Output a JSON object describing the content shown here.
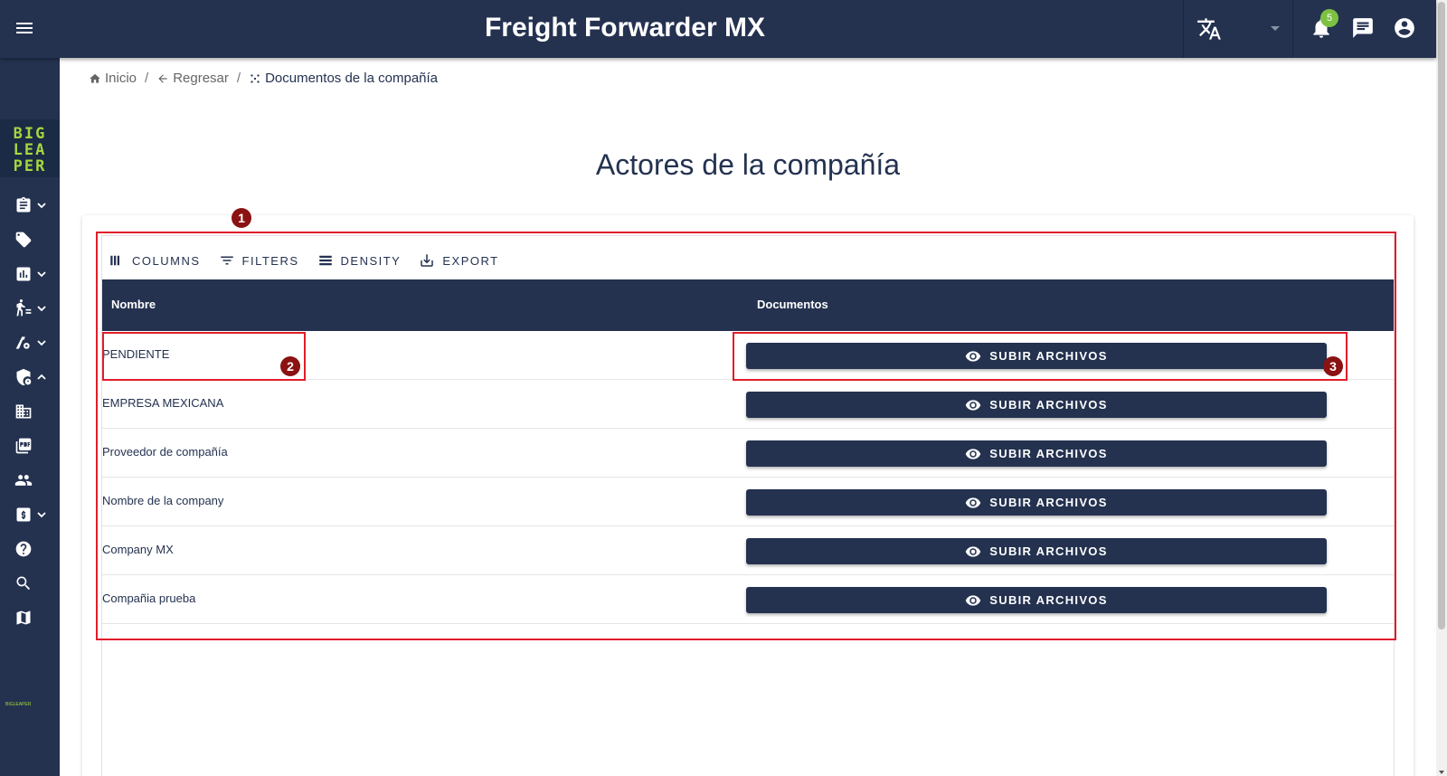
{
  "header": {
    "app_title": "Freight Forwarder MX",
    "notification_count": "5"
  },
  "breadcrumb": {
    "home": "Inicio",
    "back": "Regresar",
    "current": "Documentos de la compañía",
    "separator": "/"
  },
  "page": {
    "title": "Actores de la compañía"
  },
  "logo": {
    "lines": [
      "BIG",
      "LEA",
      "PER"
    ],
    "footer": "BIGLEAPER"
  },
  "toolbar": {
    "columns": "COLUMNS",
    "filters": "FILTERS",
    "density": "DENSITY",
    "export": "EXPORT"
  },
  "table": {
    "headers": {
      "name": "Nombre",
      "documents": "Documentos"
    },
    "button_label": "SUBIR ARCHIVOS",
    "rows": [
      {
        "name": "PENDIENTE"
      },
      {
        "name": "EMPRESA MEXICANA"
      },
      {
        "name": "Proveedor de compañía"
      },
      {
        "name": "Nombre de la company"
      },
      {
        "name": "Company MX"
      },
      {
        "name": "Compañia prueba"
      }
    ]
  },
  "annotations": {
    "m1": "1",
    "m2": "2",
    "m3": "3"
  },
  "colors": {
    "primary": "#243250",
    "accent": "#a5d63f",
    "badge": "#7cc142",
    "highlight": "#e11d2a",
    "marker": "#8b1212"
  },
  "icons": {
    "sidebar": [
      "clipboard-icon",
      "tag-icon",
      "bar-chart-icon",
      "walker-list-icon",
      "road-settings-icon",
      "shield-icon",
      "building-icon",
      "pdf-icon",
      "people-icon",
      "money-icon",
      "help-icon",
      "search-icon",
      "map-icon"
    ],
    "top": [
      "menu-icon",
      "translate-icon",
      "bell-icon",
      "chat-icon",
      "account-icon"
    ]
  }
}
